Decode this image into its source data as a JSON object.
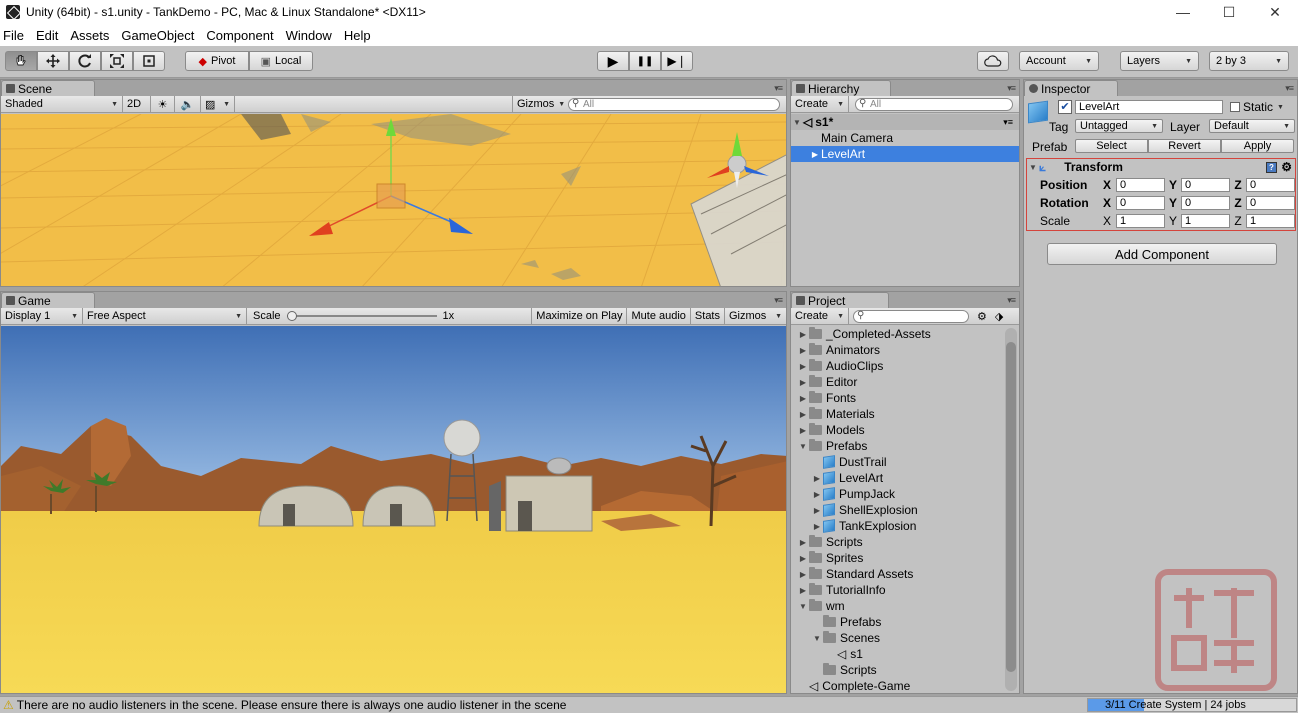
{
  "window": {
    "title": "Unity (64bit) - s1.unity - TankDemo - PC, Mac & Linux Standalone* <DX11>",
    "minimize": "—",
    "maximize": "☐",
    "close": "✕"
  },
  "menu": [
    "File",
    "Edit",
    "Assets",
    "GameObject",
    "Component",
    "Window",
    "Help"
  ],
  "toolbar": {
    "tools": [
      "hand-tool",
      "move-tool",
      "rotate-tool",
      "scale-tool",
      "rect-tool"
    ],
    "pivot": "Pivot",
    "local": "Local",
    "play": "▶",
    "pause": "❚❚",
    "step": "▶❘",
    "account": "Account",
    "layers": "Layers",
    "layout": "2 by 3"
  },
  "scene": {
    "tab": "Scene",
    "shading": "Shaded",
    "mode2d": "2D",
    "gizmos": "Gizmos",
    "search_placeholder": "All"
  },
  "game": {
    "tab": "Game",
    "display": "Display 1",
    "aspect": "Free Aspect",
    "scale_label": "Scale",
    "scale_value": "1x",
    "maximize": "Maximize on Play",
    "mute": "Mute audio",
    "stats": "Stats",
    "gizmos": "Gizmos"
  },
  "hierarchy": {
    "tab": "Hierarchy",
    "create": "Create",
    "search_placeholder": "All",
    "scene_name": "s1*",
    "items": [
      "Main Camera",
      "LevelArt"
    ],
    "selected": "LevelArt"
  },
  "project": {
    "tab": "Project",
    "create": "Create",
    "folders": [
      {
        "label": "_Completed-Assets",
        "kind": "folder",
        "indent": 0,
        "arrow": "▶"
      },
      {
        "label": "Animators",
        "kind": "folder",
        "indent": 0,
        "arrow": "▶"
      },
      {
        "label": "AudioClips",
        "kind": "folder",
        "indent": 0,
        "arrow": "▶"
      },
      {
        "label": "Editor",
        "kind": "folder",
        "indent": 0,
        "arrow": "▶"
      },
      {
        "label": "Fonts",
        "kind": "folder",
        "indent": 0,
        "arrow": "▶"
      },
      {
        "label": "Materials",
        "kind": "folder",
        "indent": 0,
        "arrow": "▶"
      },
      {
        "label": "Models",
        "kind": "folder",
        "indent": 0,
        "arrow": "▶"
      },
      {
        "label": "Prefabs",
        "kind": "folder",
        "indent": 0,
        "arrow": "▼"
      },
      {
        "label": "DustTrail",
        "kind": "prefab",
        "indent": 1,
        "arrow": ""
      },
      {
        "label": "LevelArt",
        "kind": "prefab",
        "indent": 1,
        "arrow": "▶"
      },
      {
        "label": "PumpJack",
        "kind": "prefab",
        "indent": 1,
        "arrow": "▶"
      },
      {
        "label": "ShellExplosion",
        "kind": "prefab",
        "indent": 1,
        "arrow": "▶"
      },
      {
        "label": "TankExplosion",
        "kind": "prefab",
        "indent": 1,
        "arrow": "▶"
      },
      {
        "label": "Scripts",
        "kind": "folder",
        "indent": 0,
        "arrow": "▶"
      },
      {
        "label": "Sprites",
        "kind": "folder",
        "indent": 0,
        "arrow": "▶"
      },
      {
        "label": "Standard Assets",
        "kind": "folder",
        "indent": 0,
        "arrow": "▶"
      },
      {
        "label": "TutorialInfo",
        "kind": "folder",
        "indent": 0,
        "arrow": "▶"
      },
      {
        "label": "wm",
        "kind": "folder",
        "indent": 0,
        "arrow": "▼"
      },
      {
        "label": "Prefabs",
        "kind": "folder",
        "indent": 1,
        "arrow": ""
      },
      {
        "label": "Scenes",
        "kind": "folder",
        "indent": 1,
        "arrow": "▼"
      },
      {
        "label": "s1",
        "kind": "scene",
        "indent": 2,
        "arrow": ""
      },
      {
        "label": "Scripts",
        "kind": "folder",
        "indent": 1,
        "arrow": ""
      },
      {
        "label": "Complete-Game",
        "kind": "scene",
        "indent": 0,
        "arrow": ""
      }
    ]
  },
  "inspector": {
    "tab": "Inspector",
    "object_name": "LevelArt",
    "static_label": "Static",
    "tag_label": "Tag",
    "tag_value": "Untagged",
    "layer_label": "Layer",
    "layer_value": "Default",
    "prefab_label": "Prefab",
    "select": "Select",
    "revert": "Revert",
    "apply": "Apply",
    "transform_title": "Transform",
    "position_label": "Position",
    "rotation_label": "Rotation",
    "scale_label": "Scale",
    "position": {
      "x": "0",
      "y": "0",
      "z": "0"
    },
    "rotation": {
      "x": "0",
      "y": "0",
      "z": "0"
    },
    "scale": {
      "x": "1",
      "y": "1",
      "z": "1"
    },
    "axis_x": "X",
    "axis_y": "Y",
    "axis_z": "Z",
    "add_component": "Add Component"
  },
  "status": {
    "message": "There are no audio listeners in the scene. Please ensure there is always one audio listener in the scene",
    "progress_text": "3/11 Create System | 24 jobs",
    "progress_fraction": 0.27
  },
  "colors": {
    "selection": "#3d80df",
    "sand": "#f5d04f",
    "sky": "#5f8fd0",
    "highlight_border": "#d4443c"
  }
}
